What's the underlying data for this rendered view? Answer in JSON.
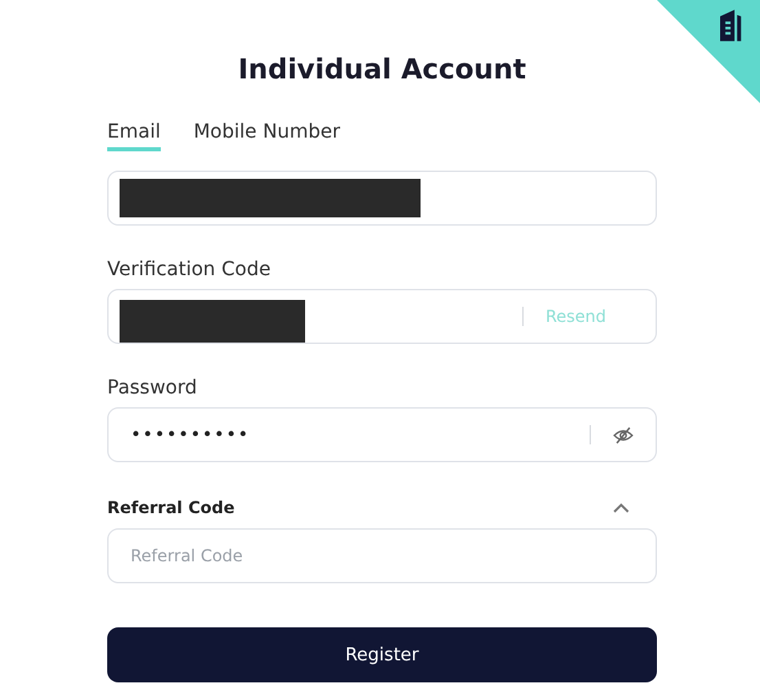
{
  "title": "Individual Account",
  "tabs": [
    {
      "label": "Email",
      "selected": true
    },
    {
      "label": "Mobile Number",
      "selected": false
    }
  ],
  "fields": [
    {
      "kind": "text",
      "redacted": true
    },
    {
      "kind": "code",
      "label": "Verification Code",
      "redacted": true,
      "action": "Resend"
    },
    {
      "kind": "password",
      "label": "Password",
      "value": "••••••••••"
    }
  ],
  "referral": {
    "label": "Referral Code",
    "expanded": true,
    "placeholder": "Referral Code"
  },
  "button": "Register"
}
